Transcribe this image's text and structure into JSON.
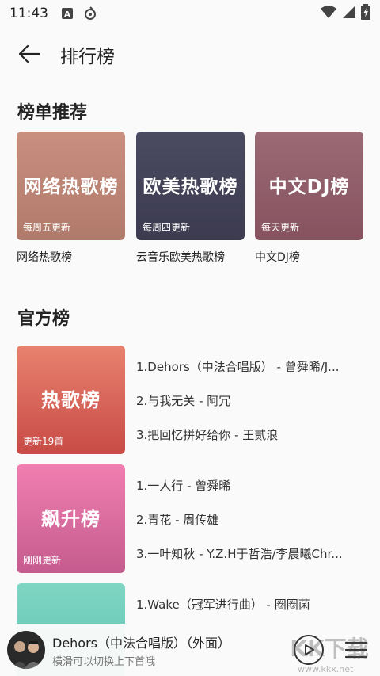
{
  "status": {
    "time": "11:43"
  },
  "header": {
    "title": "排行榜"
  },
  "recommend": {
    "title": "榜单推荐",
    "cards": [
      {
        "cover_title": "网络热歌榜",
        "cover_sub": "每周五更新",
        "name": "网络热歌榜",
        "colors": [
          "#c98f7f",
          "#b07a6b"
        ]
      },
      {
        "cover_title": "欧美热歌榜",
        "cover_sub": "每周四更新",
        "name": "云音乐欧美热歌榜",
        "colors": [
          "#4a4a60",
          "#3c3b50"
        ]
      },
      {
        "cover_title": "中文DJ榜",
        "cover_sub": "每天更新",
        "name": "中文DJ榜",
        "colors": [
          "#9a6a75",
          "#86525f"
        ]
      }
    ]
  },
  "official": {
    "title": "官方榜",
    "items": [
      {
        "cover_title": "热歌榜",
        "cover_sub": "更新19首",
        "colors": [
          "#e8826e",
          "#c84b46"
        ],
        "tracks": [
          "1.Dehors（中法合唱版） - 曾舜晞/J...",
          "2.与我无关 - 阿冗",
          "3.把回忆拼好给你 - 王贰浪"
        ]
      },
      {
        "cover_title": "飙升榜",
        "cover_sub": "刚刚更新",
        "colors": [
          "#f07fb0",
          "#c55b8e"
        ],
        "tracks": [
          "1.一人行 - 曾舜晞",
          "2.青花 - 周传雄",
          "3.一叶知秋 - Y.Z.H于哲浩/李晨曦Chr..."
        ]
      },
      {
        "cover_title": "",
        "cover_sub": "",
        "colors": [
          "#7fd6c2",
          "#5bbfb0"
        ],
        "tracks": [
          "1.Wake（冠军进行曲） - 圈圈菌"
        ]
      }
    ]
  },
  "player": {
    "song": "Dehors（中法合唱版）（外面）",
    "hint": "横滑可以切换上下首哦"
  },
  "watermark": {
    "url": "www.kkx.net"
  }
}
